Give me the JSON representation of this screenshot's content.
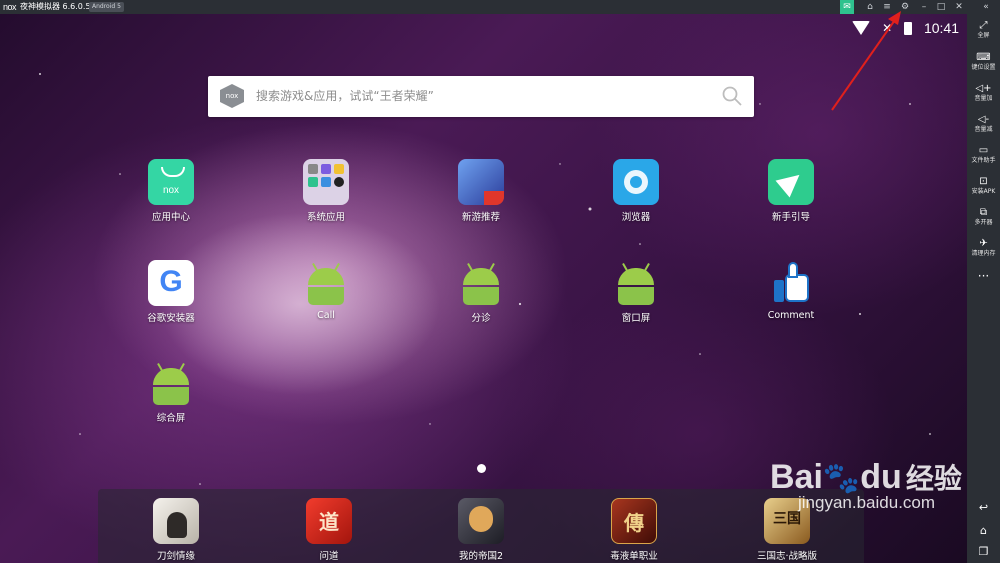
{
  "window": {
    "logo": "nox",
    "title": "夜神模拟器 6.6.0.5",
    "android_badge": "Android 5"
  },
  "titlebar_icons": [
    "mail-icon",
    "shirt-icon",
    "menu-icon",
    "settings-icon",
    "minimize-icon",
    "maximize-icon",
    "close-icon",
    "collapse-icon"
  ],
  "status_bar": {
    "time": "10:41"
  },
  "search": {
    "logo_text": "nox",
    "placeholder": "搜索游戏&应用，试试“王者荣耀”"
  },
  "apps": [
    {
      "label": "应用中心",
      "icon": "nox-app-center-icon",
      "color": "#34d6a4"
    },
    {
      "label": "系统应用",
      "icon": "system-apps-folder-icon",
      "color": "#dcd2e6"
    },
    {
      "label": "新游推荐",
      "icon": "new-games-icon",
      "color": "#3b6bd6"
    },
    {
      "label": "浏览器",
      "icon": "browser-icon",
      "color": "#2aa7e8"
    },
    {
      "label": "新手引导",
      "icon": "guide-icon",
      "color": "#2ecc8e"
    },
    {
      "label": "谷歌安装器",
      "icon": "google-icon",
      "color": "#ffffff"
    },
    {
      "label": "Call",
      "icon": "android-icon",
      "color": "#8bc34a"
    },
    {
      "label": "分诊",
      "icon": "android-icon",
      "color": "#8bc34a"
    },
    {
      "label": "窗口屏",
      "icon": "android-icon",
      "color": "#8bc34a"
    },
    {
      "label": "Comment",
      "icon": "thumbs-up-icon",
      "color": "#1e73c8"
    },
    {
      "label": "综合屏",
      "icon": "android-icon",
      "color": "#8bc34a"
    }
  ],
  "dock": [
    {
      "label": "刀剑情缘",
      "icon": "game-daojian-icon",
      "color": "#f2efe9"
    },
    {
      "label": "问道",
      "icon": "game-wendao-icon",
      "color": "#d8261b"
    },
    {
      "label": "我的帝国2",
      "icon": "game-empire-icon",
      "color": "#3a3a44"
    },
    {
      "label": "毒液单职业",
      "icon": "game-duye-icon",
      "color": "#7a1d12"
    },
    {
      "label": "三国志·战略版",
      "icon": "game-sanguo-icon",
      "color": "#c79b3c"
    }
  ],
  "sidebar": [
    {
      "label": "全屏",
      "icon": "fullscreen-icon"
    },
    {
      "label": "键位设置",
      "icon": "keyboard-icon"
    },
    {
      "label": "音量加",
      "icon": "volume-up-icon"
    },
    {
      "label": "音量减",
      "icon": "volume-down-icon"
    },
    {
      "label": "文件助手",
      "icon": "file-helper-icon"
    },
    {
      "label": "安装APK",
      "icon": "install-apk-icon"
    },
    {
      "label": "多开器",
      "icon": "multi-instance-icon"
    },
    {
      "label": "清理内存",
      "icon": "clean-memory-icon"
    }
  ],
  "watermark": {
    "brand": "Bai",
    "brand2": "du",
    "cn": "经验",
    "url": "jingyan.baidu.com"
  }
}
